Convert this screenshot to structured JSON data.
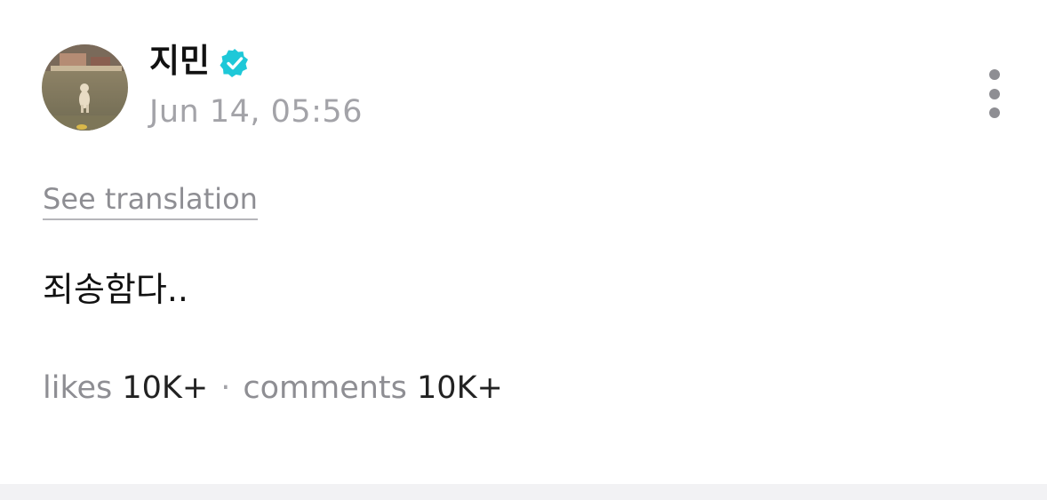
{
  "post": {
    "author": {
      "name": "지민",
      "verified": true,
      "avatar_icon": "avatar-dog-photo"
    },
    "timestamp": "Jun 14, 05:56",
    "see_translation_label": "See translation",
    "body": "죄송함다..",
    "stats": {
      "likes_label": "likes",
      "likes_value": "10K+",
      "separator": "·",
      "comments_label": "comments",
      "comments_value": "10K+"
    },
    "more_icon": "more-vertical-icon"
  },
  "colors": {
    "verified": "#1ec8d8",
    "muted_text": "#8e8e93",
    "primary_text": "#111111"
  }
}
